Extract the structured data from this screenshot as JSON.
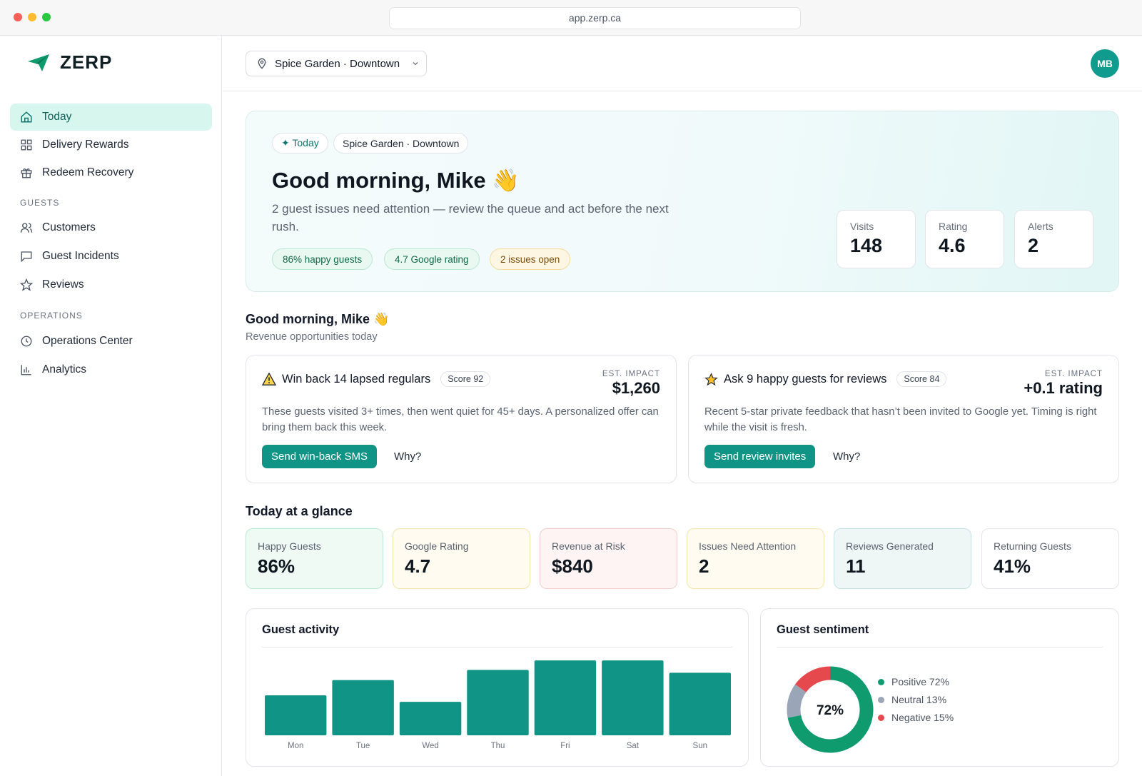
{
  "browser": {
    "url": "app.zerp.ca"
  },
  "brand": {
    "name": "ZERP",
    "accent": "#0f9485"
  },
  "sidebar": {
    "items": [
      {
        "label": "Today",
        "icon": "home-icon",
        "active": true
      },
      {
        "label": "Delivery Rewards",
        "icon": "grid-icon"
      },
      {
        "label": "Redeem Recovery",
        "icon": "gift-icon"
      },
      {
        "label": "Customers",
        "icon": "users-icon"
      },
      {
        "label": "Guest Incidents",
        "icon": "message-icon"
      },
      {
        "label": "Reviews",
        "icon": "star-icon"
      },
      {
        "label": "Operations Center",
        "icon": "clock-icon"
      },
      {
        "label": "Analytics",
        "icon": "bar-chart-icon"
      }
    ],
    "sections": {
      "guests": "GUESTS",
      "operations": "OPERATIONS"
    }
  },
  "header": {
    "location": "Spice Garden · Downtown",
    "avatar_initials": "MB"
  },
  "hero": {
    "chip_today": "✦ Today",
    "chip_location": "Spice Garden · Downtown",
    "title": "Good morning, Mike 👋",
    "subtitle": "2 guest issues need attention — review the queue and act before the next rush.",
    "pills": [
      "86% happy guests",
      "4.7 Google rating",
      "2 issues open"
    ],
    "stats": [
      {
        "label": "Visits",
        "value": "148"
      },
      {
        "label": "Rating",
        "value": "4.6"
      },
      {
        "label": "Alerts",
        "value": "2"
      }
    ]
  },
  "opportunities": {
    "heading": "Good morning, Mike 👋",
    "subheading": "Revenue opportunities today",
    "cards": [
      {
        "icon": "warning-icon",
        "title": "Win back 14 lapsed regulars",
        "score": "Score 92",
        "est_label": "EST. IMPACT",
        "est_value": "$1,260",
        "body": "These guests visited 3+ times, then went quiet for 45+ days. A personalized offer can bring them back this week.",
        "action": "Send win-back SMS",
        "why": "Why?"
      },
      {
        "icon": "star-icon",
        "title": "Ask 9 happy guests for reviews",
        "score": "Score 84",
        "est_label": "EST. IMPACT",
        "est_value": "+0.1 rating",
        "body": "Recent 5-star private feedback that hasn’t been invited to Google yet. Timing is right while the visit is fresh.",
        "action": "Send review invites",
        "why": "Why?"
      }
    ]
  },
  "glance": {
    "heading": "Today at a glance",
    "kpis": [
      {
        "label": "Happy Guests",
        "value": "86%",
        "bg": "#effaf5",
        "border": "#bde9d3"
      },
      {
        "label": "Google Rating",
        "value": "4.7",
        "bg": "#fffbf0",
        "border": "#f5e3ae"
      },
      {
        "label": "Revenue at Risk",
        "value": "$840",
        "bg": "#fdf4f3",
        "border": "#f3cfcb"
      },
      {
        "label": "Issues Need Attention",
        "value": "2",
        "bg": "#fffbf0",
        "border": "#f5e3ae"
      },
      {
        "label": "Reviews Generated",
        "value": "11",
        "bg": "#eff6f6",
        "border": "#c3e3e1"
      },
      {
        "label": "Returning Guests",
        "value": "41%",
        "bg": "#ffffff",
        "border": "#e2e5ea"
      }
    ]
  },
  "chart_data": [
    {
      "type": "bar",
      "title": "Guest activity",
      "categories": [
        "Mon",
        "Tue",
        "Wed",
        "Thu",
        "Fri",
        "Sat",
        "Sun"
      ],
      "values": [
        55,
        76,
        46,
        90,
        103,
        103,
        86
      ],
      "ylim": [
        0,
        110
      ],
      "color": "#0f9485",
      "grid": false
    },
    {
      "type": "pie",
      "title": "Guest sentiment",
      "center_label": "72%",
      "slices": [
        {
          "label": "Positive 72%",
          "value": 72,
          "color": "#0f9b6e"
        },
        {
          "label": "Neutral 13%",
          "value": 13,
          "color": "#9aa6b8"
        },
        {
          "label": "Negative 15%",
          "value": 15,
          "color": "#e5484d"
        }
      ]
    }
  ]
}
